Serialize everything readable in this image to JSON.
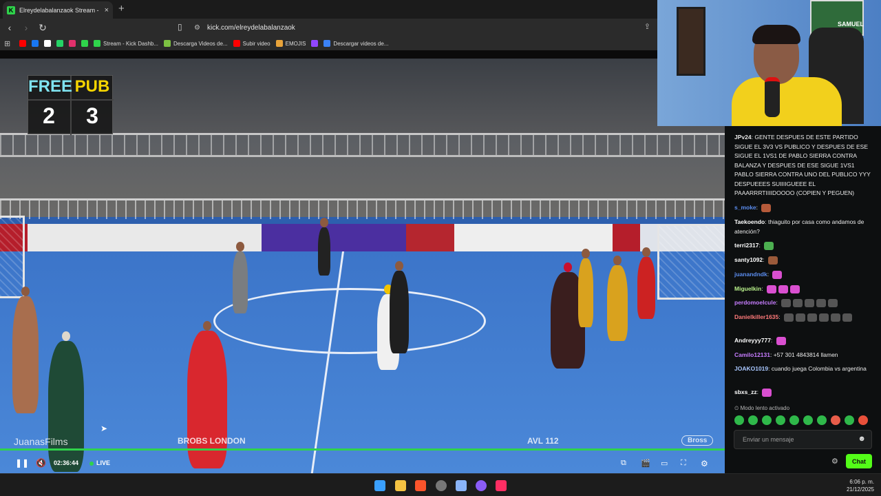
{
  "browser": {
    "tab_title": "Elreydelabalanzaok Stream - K",
    "tab_close": "×",
    "new_tab": "+",
    "url": "kick.com/elreydelabalanzaok",
    "bookmarks": [
      {
        "label": "",
        "icon": "youtube-icon",
        "color": "#ff0000"
      },
      {
        "label": "",
        "icon": "facebook-icon",
        "color": "#1877f2"
      },
      {
        "label": "",
        "icon": "x-icon",
        "color": "#ffffff"
      },
      {
        "label": "",
        "icon": "whatsapp-icon",
        "color": "#25d366"
      },
      {
        "label": "",
        "icon": "instagram-icon",
        "color": "#e1306c"
      },
      {
        "label": "",
        "icon": "kick-icon",
        "color": "#2fd34b"
      },
      {
        "label": "Stream - Kick Dashb...",
        "icon": "kick-icon",
        "color": "#2fd34b"
      },
      {
        "label": "Descarga Videos de...",
        "icon": "download-icon",
        "color": "#7cc142"
      },
      {
        "label": "Subir video",
        "icon": "youtube-icon",
        "color": "#ff0000"
      },
      {
        "label": "EMOJIS",
        "icon": "emoji-icon",
        "color": "#e8a33a"
      },
      {
        "label": "",
        "icon": "twitch-icon",
        "color": "#9146ff"
      },
      {
        "label": "Descargar videos de...",
        "icon": "download-icon",
        "color": "#3b82f6"
      }
    ]
  },
  "scoreboard": {
    "team_left": "FREE",
    "team_right": "PUB",
    "score_left": "2",
    "score_right": "3"
  },
  "watermarks": {
    "left": "JuanasFilms",
    "center": "BROBS LONDON",
    "right": "AVL 112",
    "corner": "Bross"
  },
  "player": {
    "time": "02:36:44",
    "live_label": "LIVE",
    "accent": "#2fd34b"
  },
  "webcam": {
    "poster_text": "SAMUEL"
  },
  "chat": {
    "messages": [
      {
        "user": "JPv24",
        "color": "#e8e8e8",
        "text": "GENTE DESPUES DE ESTE PARTIDO SIGUE EL 3V3 VS PUBLICO Y DESPUES DE ESE SIGUE EL 1VS1 DE PABLO SIERRA CONTRA BALANZA Y DESPUES DE ESE SIGUE 1VS1 PABLO SIERRA CONTRA UNO DEL PUBLICO YYY DESPUEEES SUIIIIGUEEE EL PAAARRRTIIIIDOOOO (COPIEN Y PEGUEN)"
      },
      {
        "user": "s_moke",
        "color": "#5b8def",
        "text": ""
      },
      {
        "user": "Taekoendo",
        "color": "#ffffff",
        "text": "thiaguito por casa como andamos de atención?"
      },
      {
        "user": "terri2317",
        "color": "#ffffff",
        "text": ""
      },
      {
        "user": "santy1092",
        "color": "#ffffff",
        "text": ""
      },
      {
        "user": "juanandndk",
        "color": "#5b8def",
        "text": ""
      },
      {
        "user": "Miguelkin",
        "color": "#b8f08a",
        "text": ""
      },
      {
        "user": "perdomoelcule",
        "color": "#c77dff",
        "text": ""
      },
      {
        "user": "Danielkiller1635",
        "color": "#ff7a7a",
        "text": ""
      },
      {
        "user": "Andreyyy777",
        "color": "#ffffff",
        "text": ""
      },
      {
        "user": "Camilo12131",
        "color": "#c77dff",
        "text": "+57 301 4843814 llamen"
      },
      {
        "user": "JOAKO1019",
        "color": "#a9c7ff",
        "text": "cuando juega Colombia vs argentina"
      },
      {
        "user": "sbxs_zz",
        "color": "#ffffff",
        "text": ""
      }
    ],
    "slow_mode": "Modo lento activado",
    "input_placeholder": "Enviar un mensaje",
    "send_label": "Chat",
    "accent": "#53fc18"
  },
  "taskbar": {
    "time": "6:06 p. m.",
    "date": "21/12/2025"
  }
}
